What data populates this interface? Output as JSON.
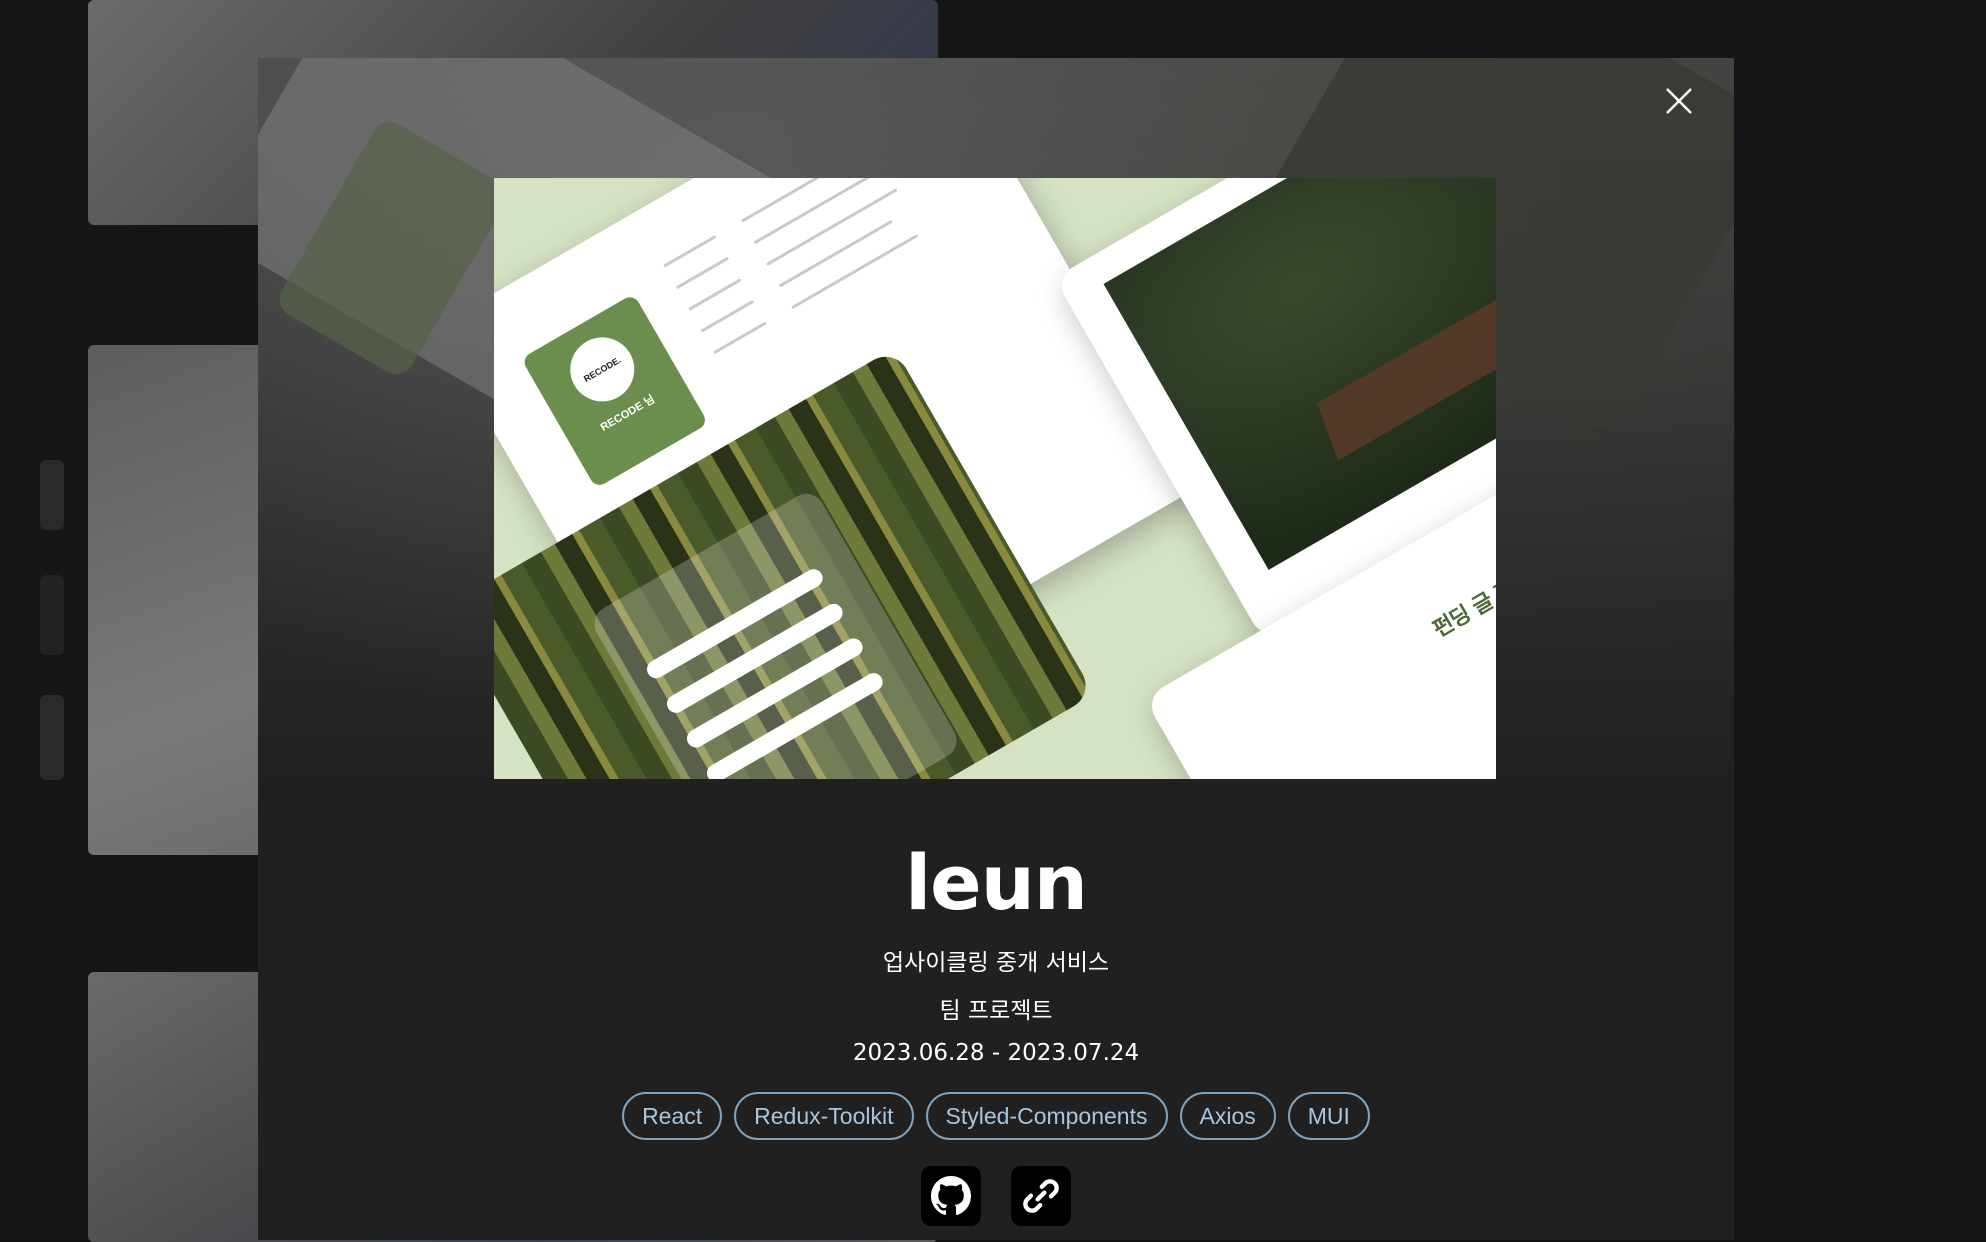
{
  "project": {
    "title": "leun",
    "description": "업사이클링 중개 서비스",
    "type": "팀 프로젝트",
    "period": "2023.06.28 - 2023.07.24",
    "tech_stack": [
      "React",
      "Redux-Toolkit",
      "Styled-Components",
      "Axios",
      "MUI"
    ]
  },
  "modal": {
    "close_icon": "close-icon"
  },
  "links": {
    "github_icon": "github-icon",
    "link_icon": "link-icon"
  },
  "preview": {
    "profile_badge": "RECODE.",
    "profile_name": "RECODE 님",
    "write_title": "펀딩 글 작성"
  },
  "colors": {
    "modal_bg": "#202020",
    "tag_border": "#7fa3bf",
    "tag_text": "#a8c6de",
    "hero_bg": "#d5e2c4",
    "brand_green": "#6b8e4e"
  }
}
